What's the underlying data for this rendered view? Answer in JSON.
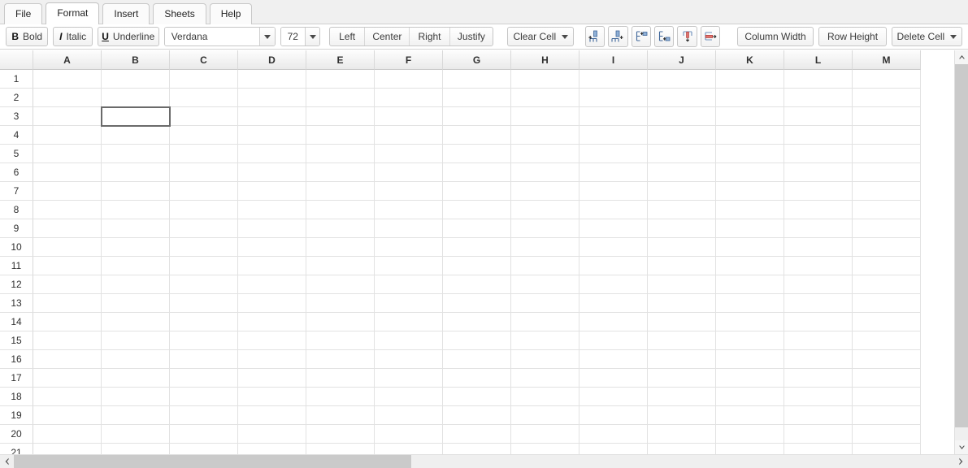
{
  "menu": {
    "tabs": [
      {
        "label": "File",
        "active": false
      },
      {
        "label": "Format",
        "active": true
      },
      {
        "label": "Insert",
        "active": false
      },
      {
        "label": "Sheets",
        "active": false
      },
      {
        "label": "Help",
        "active": false
      }
    ]
  },
  "toolbar": {
    "bold_label": "Bold",
    "bold_glyph": "B",
    "italic_label": "Italic",
    "italic_glyph": "I",
    "underline_label": "Underline",
    "underline_glyph": "U",
    "font_name_value": "Verdana",
    "font_size_value": "72",
    "align_left_label": "Left",
    "align_center_label": "Center",
    "align_right_label": "Right",
    "align_justify_label": "Justify",
    "clear_cell_label": "Clear Cell",
    "icon_buttons": [
      {
        "name": "insert-column-left-icon",
        "title": "Insert Column Left"
      },
      {
        "name": "insert-column-right-icon",
        "title": "Insert Column Right"
      },
      {
        "name": "insert-row-above-icon",
        "title": "Insert Row Above"
      },
      {
        "name": "insert-row-below-icon",
        "title": "Insert Row Below"
      },
      {
        "name": "delete-column-icon",
        "title": "Delete Column"
      },
      {
        "name": "delete-row-icon",
        "title": "Delete Row"
      }
    ],
    "column_width_label": "Column Width",
    "row_height_label": "Row Height",
    "delete_cell_label": "Delete Cell"
  },
  "sheet": {
    "columns": [
      "A",
      "B",
      "C",
      "D",
      "E",
      "F",
      "G",
      "H",
      "I",
      "J",
      "K",
      "L",
      "M"
    ],
    "rows": [
      "1",
      "2",
      "3",
      "4",
      "5",
      "6",
      "7",
      "8",
      "9",
      "10",
      "11",
      "12",
      "13",
      "14",
      "15",
      "16",
      "17",
      "18",
      "19",
      "20",
      "21"
    ],
    "cell_values": {},
    "selected_cell": "B3",
    "selected_col_index": 1,
    "selected_row_index": 2
  },
  "colors": {
    "selection_border": "#6a6a6a",
    "grid_line": "#e2e2e2",
    "header_border": "#d9d9d9",
    "scrollbar_thumb": "#cacaca",
    "scrollbar_track": "#efefef",
    "icon_blue": "#4a6fa5",
    "icon_red": "#d95555"
  },
  "scrollbars": {
    "h_left_arrow": "chevron-left",
    "h_right_arrow": "chevron-right",
    "v_up_arrow": "chevron-up",
    "v_down_arrow": "chevron-down"
  }
}
